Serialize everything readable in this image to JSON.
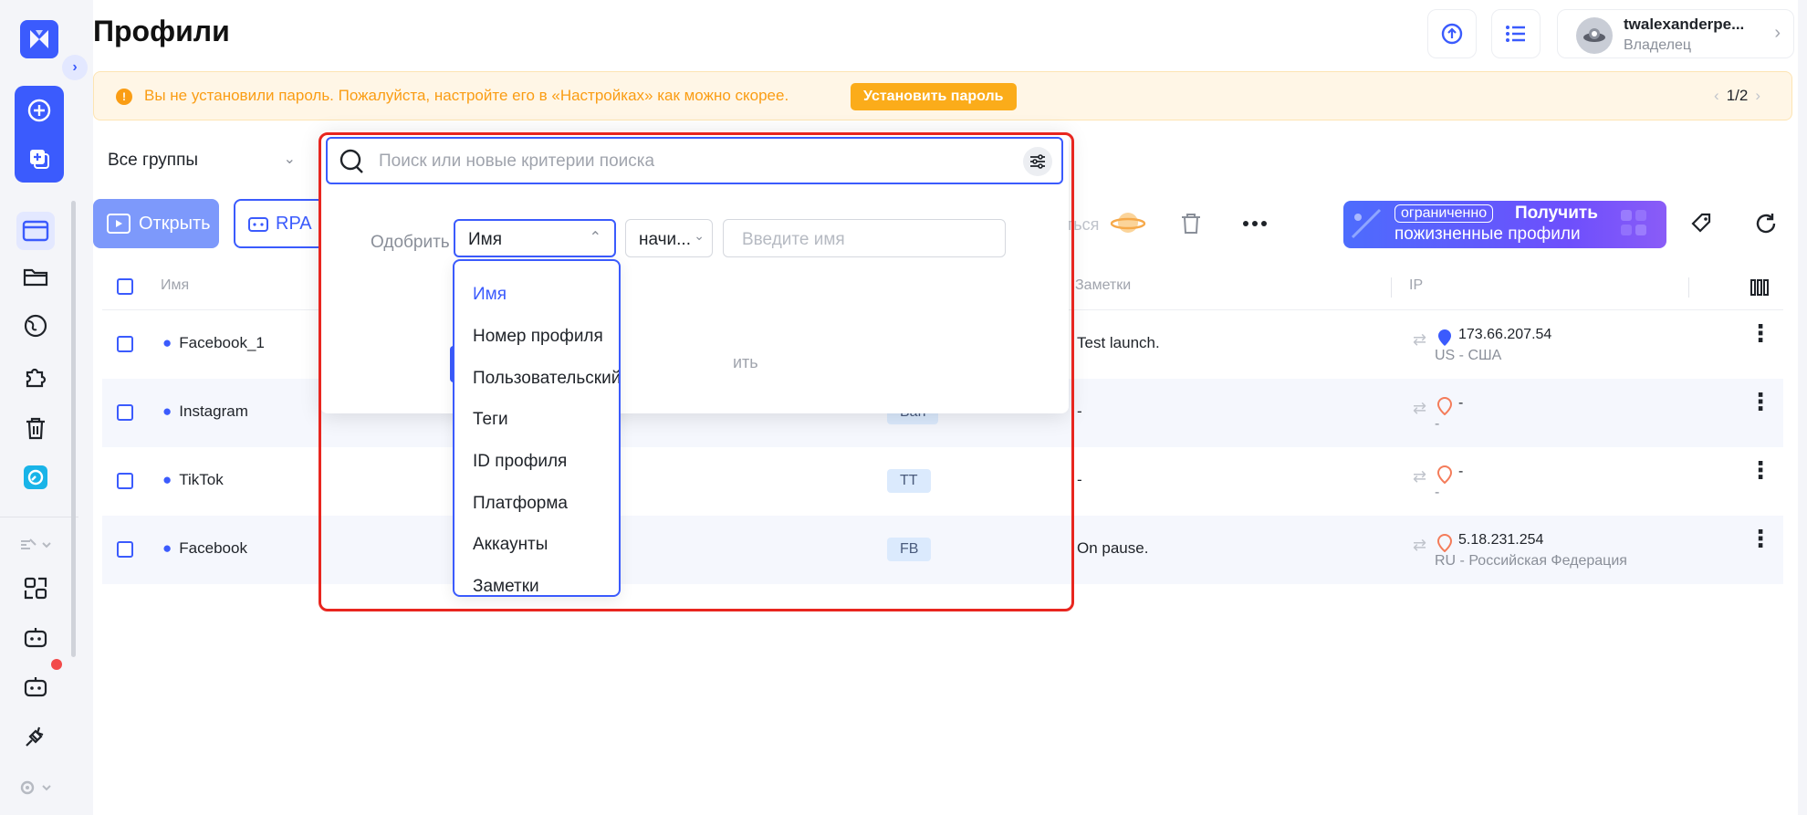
{
  "page_title": "Профили",
  "user": {
    "name": "twalexanderpe...",
    "role": "Владелец"
  },
  "banner": {
    "text": "Вы не установили пароль. Пожалуйста, настройте его в «Настройках» как можно скорее.",
    "button": "Установить пароль",
    "pager": "1/2"
  },
  "group_select": "Все группы",
  "toolbar": {
    "open": "Открыть",
    "rpa": "RPA",
    "behind_text": "ться"
  },
  "promo": {
    "tag": "ограниченно",
    "title": "Получить",
    "subtitle": "пожизненные профили"
  },
  "table": {
    "headers": {
      "name": "Имя",
      "notes": "Заметки",
      "ip": "IP"
    },
    "rows": [
      {
        "name": "Facebook_1",
        "tag": "",
        "note": "Test launch.",
        "ip": "173.66.207.54",
        "location": "US - США",
        "pin_color": "#3b5bfd"
      },
      {
        "name": "Instagram",
        "tag": "Ban",
        "note": "-",
        "ip": "-",
        "location": "-",
        "pin_color": "#f47c5a"
      },
      {
        "name": "TikTok",
        "tag": "TT",
        "note": "-",
        "ip": "-",
        "location": "-",
        "pin_color": "#f47c5a"
      },
      {
        "name": "Facebook",
        "tag": "FB",
        "note": "On pause.",
        "ip": "5.18.231.254",
        "location": "RU - Российская Федерация",
        "pin_color": "#f47c5a"
      }
    ]
  },
  "search_panel": {
    "placeholder": "Поиск или новые критерии поиска",
    "approve_label": "Одобрить",
    "field_value": "Имя",
    "operator_value": "начи...",
    "value_placeholder": "Введите имя",
    "hidden_text": "ить"
  },
  "dropdown": {
    "options": [
      "Имя",
      "Номер профиля",
      "Пользовательский №",
      "Теги",
      "ID профиля",
      "Платформа",
      "Аккаунты",
      "Заметки"
    ],
    "selected": "Имя"
  },
  "colors": {
    "accent": "#3b5bfd",
    "warning": "#fa9d14",
    "highlight": "#e8261f"
  }
}
